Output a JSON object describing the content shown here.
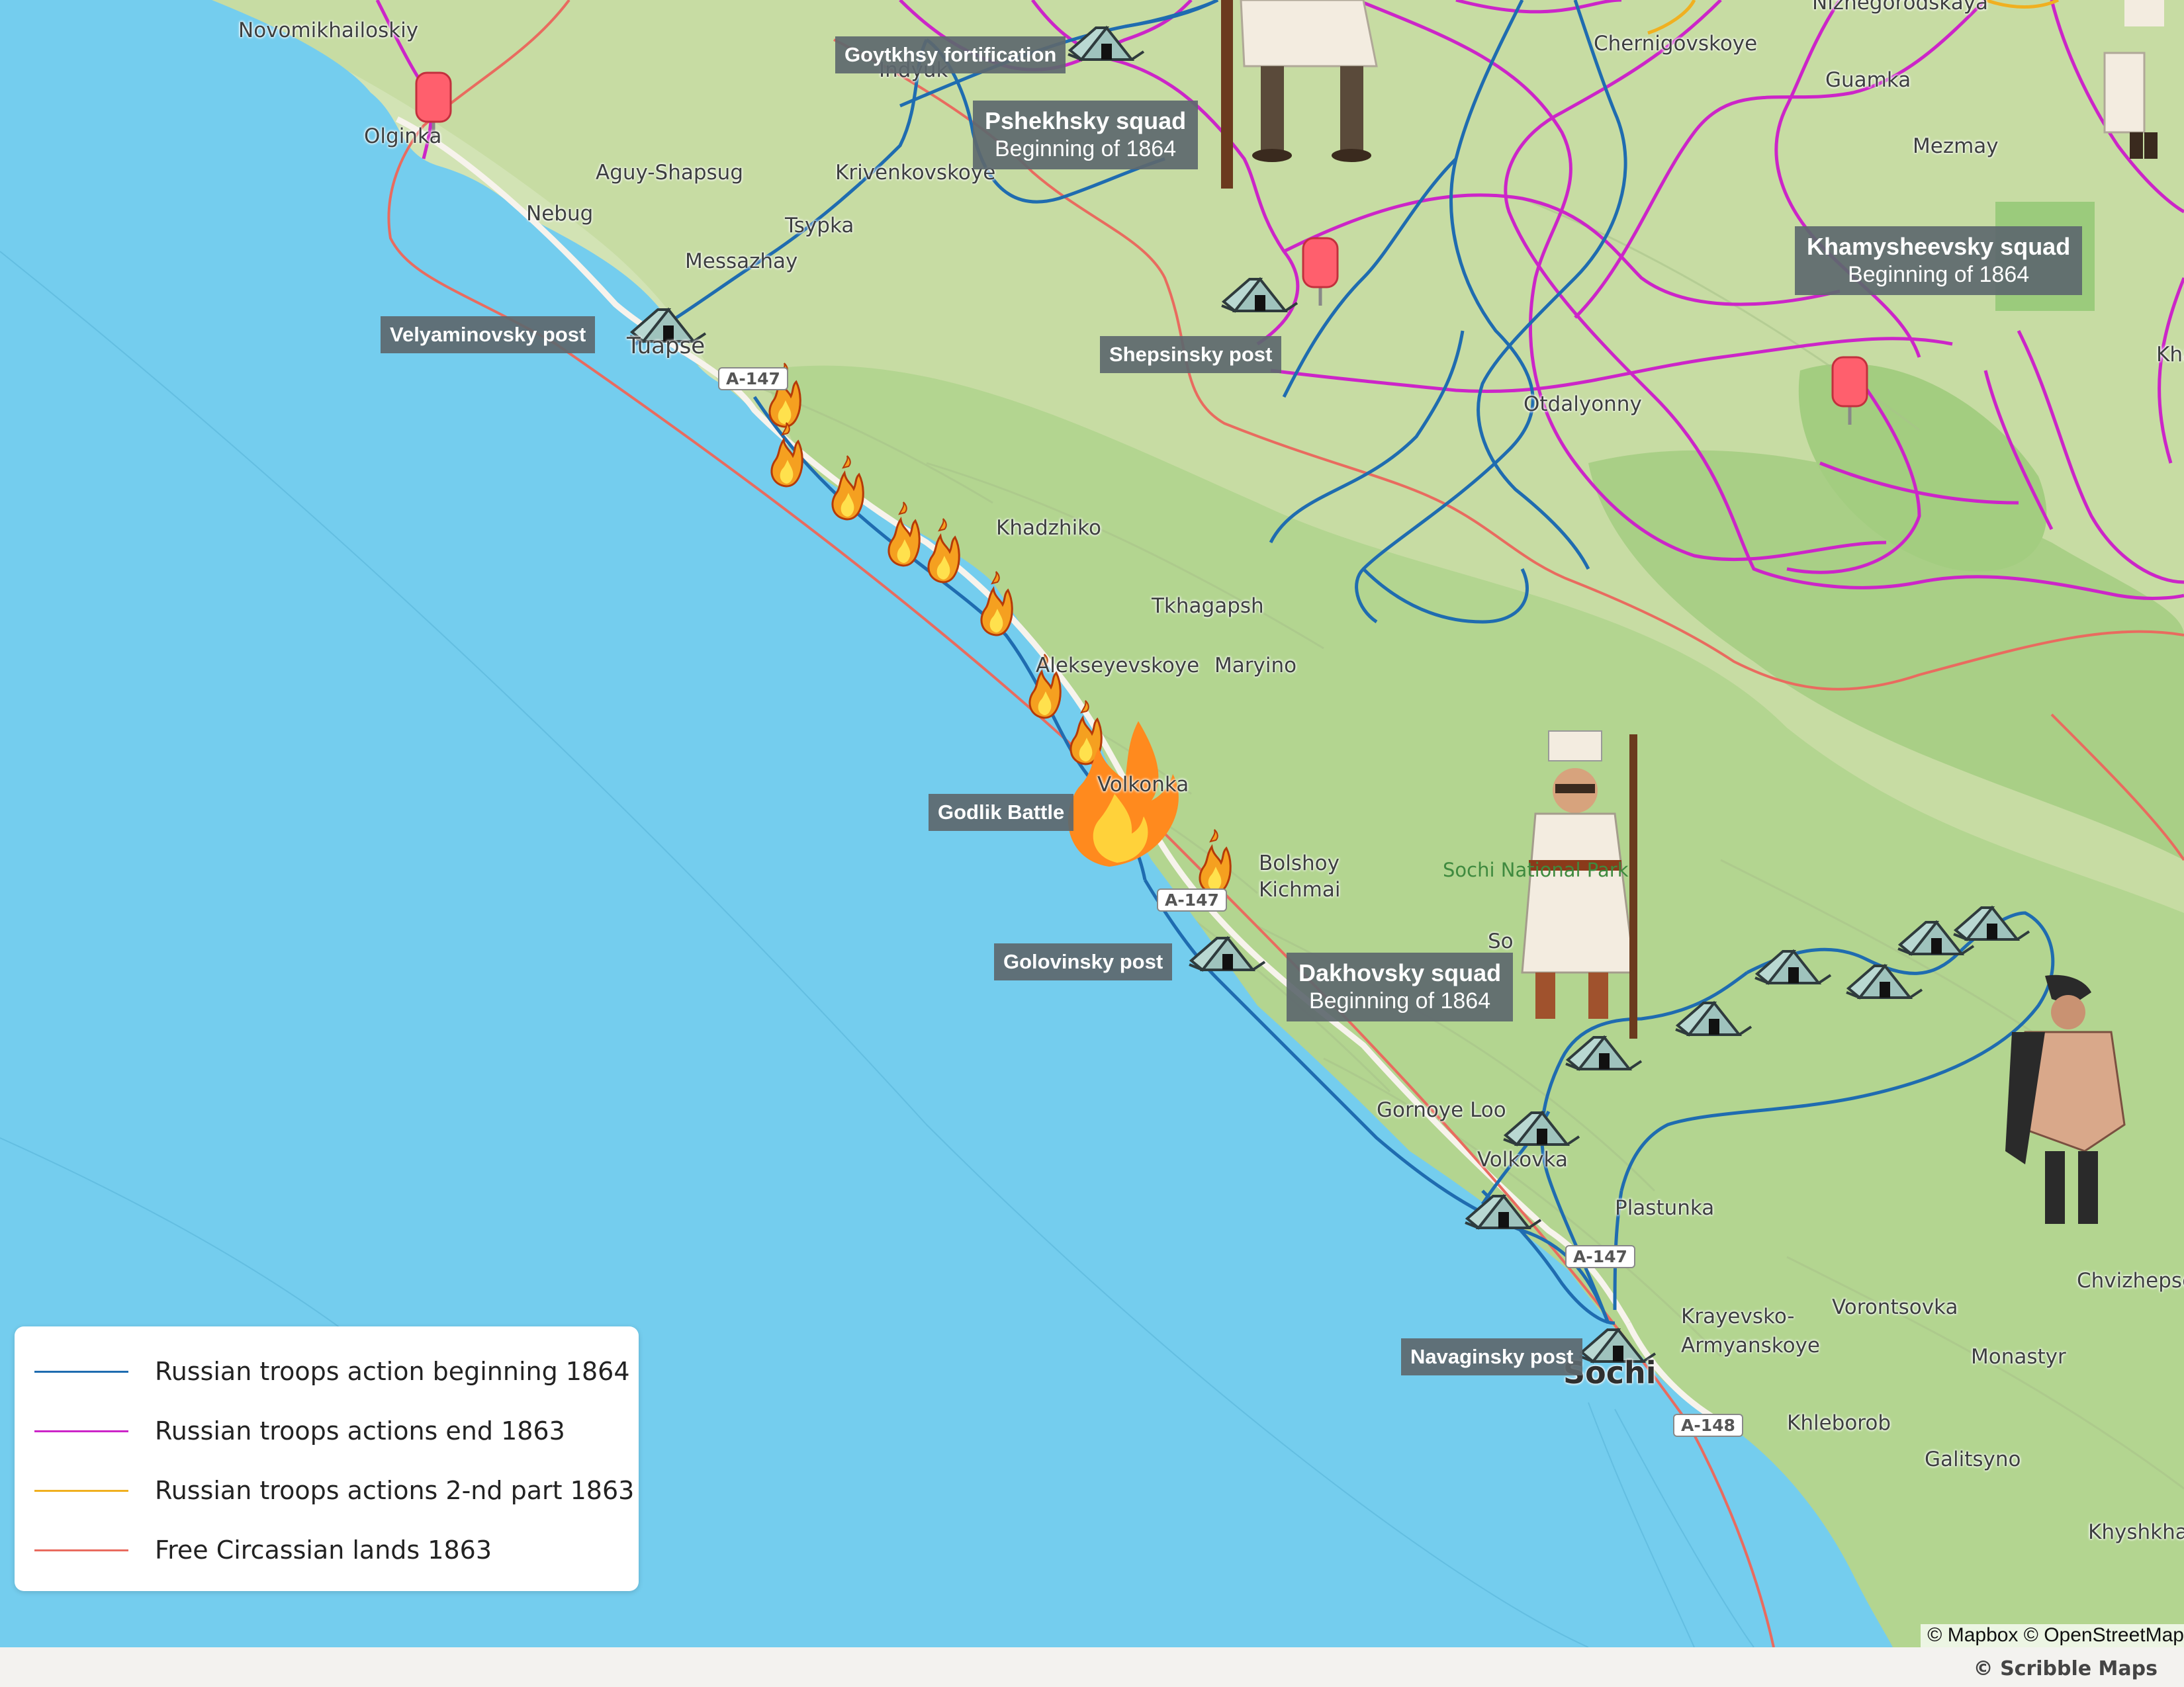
{
  "colors": {
    "sea": "#74cdee",
    "land": "#c7dca3",
    "forest": "#acd28c",
    "route_1864": "#1f6cb0",
    "route_end_1863": "#cc25c8",
    "route_2nd_1863": "#f0b020",
    "free_lands_1863": "#e96b5f"
  },
  "towns": [
    "Novomikhailoskiy",
    "Olginka",
    "Aguy-Shapsug",
    "Nebug",
    "Krivenkovskoye",
    "Tsypka",
    "Messazhay",
    "Tuapse",
    "Indyuk",
    "Chernigovskoye",
    "Nizhegorodskaya",
    "Guamka",
    "Mezmay",
    "Otdalyonny",
    "Khadzhiko",
    "Tkhagapsh",
    "Alekseyevskoye",
    "Maryino",
    "Volkonka",
    "Bolshoy Kichmai",
    "Sochi National Park",
    "Gornoye Loo",
    "Volkovka",
    "Plastunka",
    "Vorontsovka",
    "Krayevsko-Armyanskoye",
    "Chvizhepse",
    "Monastyr",
    "Khleborob",
    "Galitsyno",
    "Khyshkhari",
    "Sochi",
    "Kha",
    "So"
  ],
  "roads": [
    "A-147",
    "A-147",
    "A-147",
    "A-148"
  ],
  "posts": [
    "Goytkhsy fortification",
    "Velyaminovsky post",
    "Shepsinsky post",
    "Godlik Battle",
    "Golovinsky post",
    "Navaginsky post"
  ],
  "squads": [
    {
      "name": "Pshekhsky squad",
      "date": "Beginning of 1864"
    },
    {
      "name": "Khamysheevsky squad",
      "date": "Beginning of 1864"
    },
    {
      "name": "Dakhovsky squad",
      "date": "Beginning of 1864"
    }
  ],
  "legend": [
    {
      "label": "Russian troops action beginning 1864",
      "color": "#1f6cb0"
    },
    {
      "label": "Russian troops actions end 1863",
      "color": "#cc25c8"
    },
    {
      "label": "Russian troops actions 2-nd part 1863",
      "color": "#f0b020"
    },
    {
      "label": "Free Circassian lands 1863",
      "color": "#e96b5f"
    }
  ],
  "attribution": "© Mapbox © OpenStreetMap",
  "brand": "© Scribble Maps"
}
